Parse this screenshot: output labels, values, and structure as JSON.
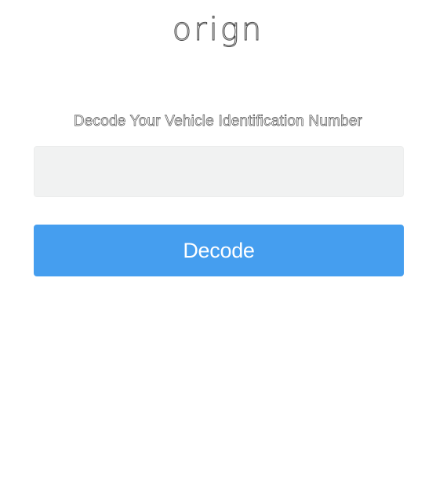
{
  "brand": {
    "logo_text": "orign"
  },
  "decoder": {
    "heading": "Decode Your Vehicle Identification Number",
    "vin_input": {
      "value": "",
      "placeholder": ""
    },
    "decode_button_label": "Decode"
  },
  "colors": {
    "accent": "#459eef",
    "input_background": "#f1f2f2",
    "page_background": "#ffffff"
  }
}
